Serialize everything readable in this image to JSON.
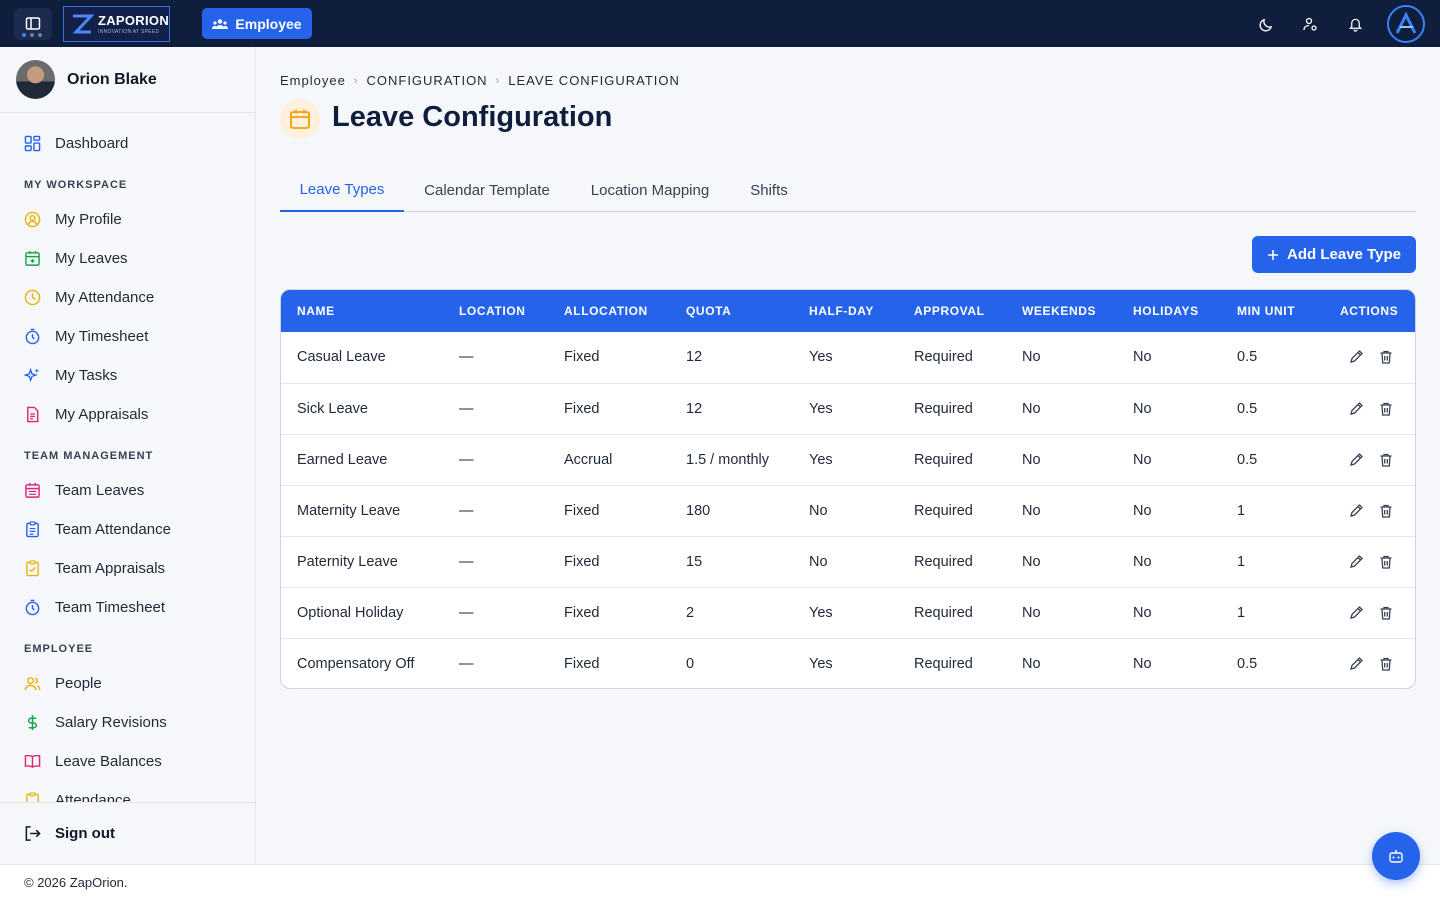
{
  "topbar": {
    "logo_brand": "ZAPORION",
    "logo_tagline": "INNOVATION AT SPEED",
    "module_button": "Employee",
    "icons": [
      "sidebar-toggle-icon",
      "moon-icon",
      "user-settings-icon",
      "bell-icon"
    ]
  },
  "user": {
    "name": "Orion Blake"
  },
  "sidebar": {
    "dashboard": "Dashboard",
    "sections": {
      "workspace": "MY WORKSPACE",
      "team": "TEAM MANAGEMENT",
      "employee": "EMPLOYEE"
    },
    "workspace_items": [
      "My Profile",
      "My Leaves",
      "My Attendance",
      "My Timesheet",
      "My Tasks",
      "My Appraisals"
    ],
    "team_items": [
      "Team Leaves",
      "Team Attendance",
      "Team Appraisals",
      "Team Timesheet"
    ],
    "employee_items": [
      "People",
      "Salary Revisions",
      "Leave Balances",
      "Attendance"
    ],
    "signout": "Sign out",
    "colors": {
      "amber": "#eab308",
      "green": "#16a34a",
      "blue": "#2563eb",
      "pink": "#db2777"
    }
  },
  "breadcrumbs": [
    "Employee",
    "CONFIGURATION",
    "LEAVE CONFIGURATION"
  ],
  "page": {
    "title": "Leave Configuration"
  },
  "tabs": [
    "Leave Types",
    "Calendar Template",
    "Location Mapping",
    "Shifts"
  ],
  "actions": {
    "add_leave_type": "Add Leave Type"
  },
  "table": {
    "headers": [
      "NAME",
      "LOCATION",
      "ALLOCATION",
      "QUOTA",
      "HALF-DAY",
      "APPROVAL",
      "WEEKENDS",
      "HOLIDAYS",
      "MIN UNIT",
      "ACTIONS"
    ],
    "rows": [
      [
        "Casual Leave",
        "—",
        "Fixed",
        "12",
        "Yes",
        "Required",
        "No",
        "No",
        "0.5"
      ],
      [
        "Sick Leave",
        "—",
        "Fixed",
        "12",
        "Yes",
        "Required",
        "No",
        "No",
        "0.5"
      ],
      [
        "Earned Leave",
        "—",
        "Accrual",
        "1.5 / monthly",
        "Yes",
        "Required",
        "No",
        "No",
        "0.5"
      ],
      [
        "Maternity Leave",
        "—",
        "Fixed",
        "180",
        "No",
        "Required",
        "No",
        "No",
        "1"
      ],
      [
        "Paternity Leave",
        "—",
        "Fixed",
        "15",
        "No",
        "Required",
        "No",
        "No",
        "1"
      ],
      [
        "Optional Holiday",
        "—",
        "Fixed",
        "2",
        "Yes",
        "Required",
        "No",
        "No",
        "1"
      ],
      [
        "Compensatory Off",
        "—",
        "Fixed",
        "0",
        "Yes",
        "Required",
        "No",
        "No",
        "0.5"
      ]
    ]
  },
  "footer": {
    "copyright": "© 2026 ZapOrion."
  },
  "accent": "#2563eb"
}
